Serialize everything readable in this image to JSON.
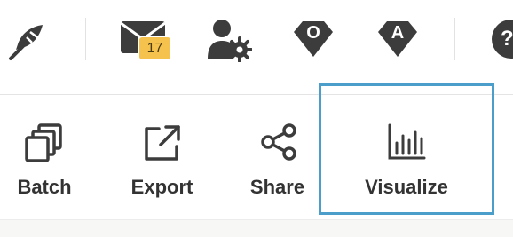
{
  "header": {
    "icons": [
      {
        "name": "feather-icon"
      },
      {
        "name": "mail-icon",
        "badge": "17"
      },
      {
        "name": "user-settings-icon"
      },
      {
        "name": "shield-icon",
        "letter": "O"
      },
      {
        "name": "shield-icon",
        "letter": "A"
      },
      {
        "name": "help-icon",
        "letter": "?"
      }
    ],
    "badge_color": "#f5c34d"
  },
  "toolbar": {
    "batch_label": "Batch",
    "export_label": "Export",
    "share_label": "Share",
    "visualize_label": "Visualize",
    "selected": "Visualize",
    "selection_color": "#4b9ec9"
  }
}
